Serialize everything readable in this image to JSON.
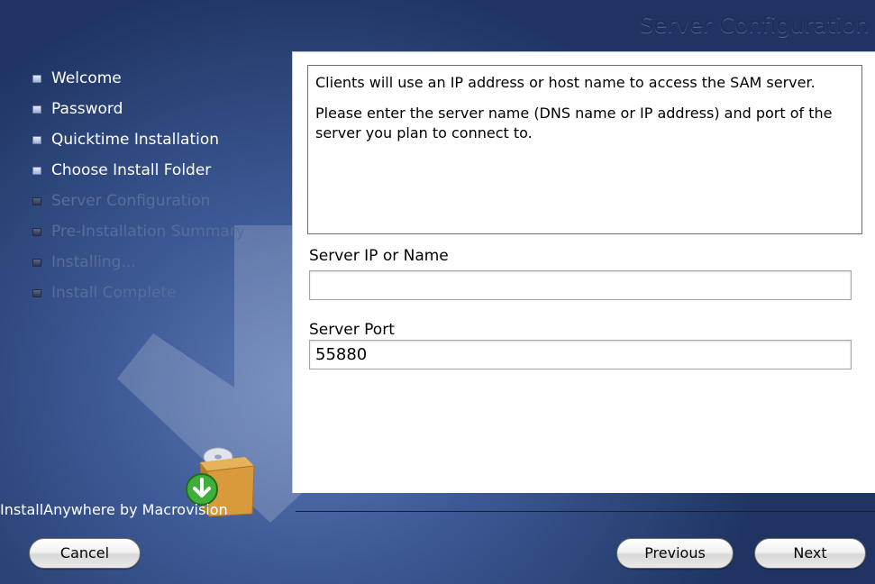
{
  "header": {
    "title": "Server Configuration"
  },
  "steps": [
    {
      "label": "Welcome",
      "state": "done"
    },
    {
      "label": "Password",
      "state": "done"
    },
    {
      "label": "Quicktime Installation",
      "state": "done"
    },
    {
      "label": "Choose Install Folder",
      "state": "done"
    },
    {
      "label": "Server Configuration",
      "state": "current"
    },
    {
      "label": "Pre-Installation Summary",
      "state": "pending"
    },
    {
      "label": "Installing...",
      "state": "pending"
    },
    {
      "label": "Install Complete",
      "state": "pending"
    }
  ],
  "info": {
    "line1": "Clients will use an IP address or host name to access the SAM server.",
    "line2": "Please enter the server name (DNS name or IP address) and port of the server you plan to connect to."
  },
  "fields": {
    "server_name_label": "Server IP or Name",
    "server_name_value": "",
    "server_port_label": "Server Port",
    "server_port_value": "55880"
  },
  "footer": {
    "brand": "InstallAnywhere by Macrovision",
    "cancel": "Cancel",
    "previous": "Previous",
    "next": "Next"
  }
}
